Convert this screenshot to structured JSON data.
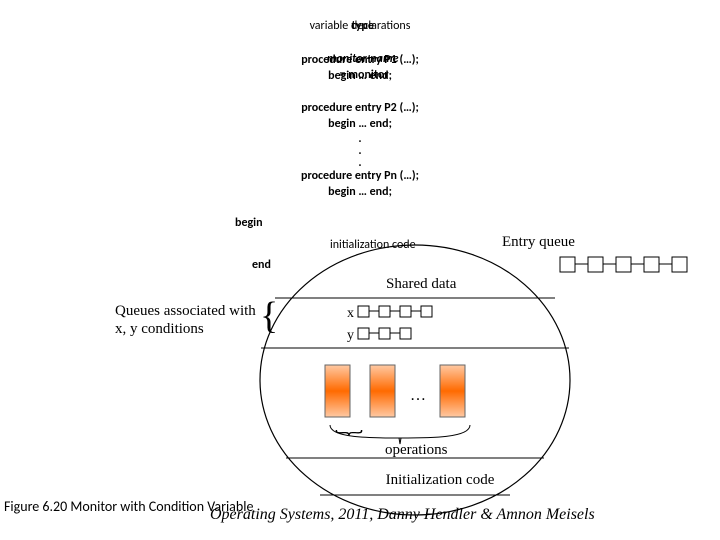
{
  "header": {
    "type_kw": "type",
    "monitor_name": "monitor-name",
    "equals_monitor": " = monitor",
    "var_decl": "variable declarations"
  },
  "procs": {
    "p1": "procedure entry P1 (…);",
    "p1b": "begin … end;",
    "p2": "procedure entry P2 (…);",
    "p2b": "begin … end;",
    "dot": ".",
    "pn": "procedure entry Pn (…);",
    "pnb": "begin … end;"
  },
  "block": {
    "begin": "begin",
    "init": "initialization code",
    "end": "end"
  },
  "labels": {
    "entry_queue": "Entry queue",
    "shared_data": "Shared data",
    "queues_assoc": "Queues associated with x, y conditions",
    "x": "x",
    "y": "y",
    "operations": "operations",
    "init_code": "Initialization code",
    "ellipsis": "…"
  },
  "caption": "Figure 6.20  Monitor with Condition Variable",
  "footer": "Operating Systems, 2011, Danny Hendler & Amnon Meisels"
}
